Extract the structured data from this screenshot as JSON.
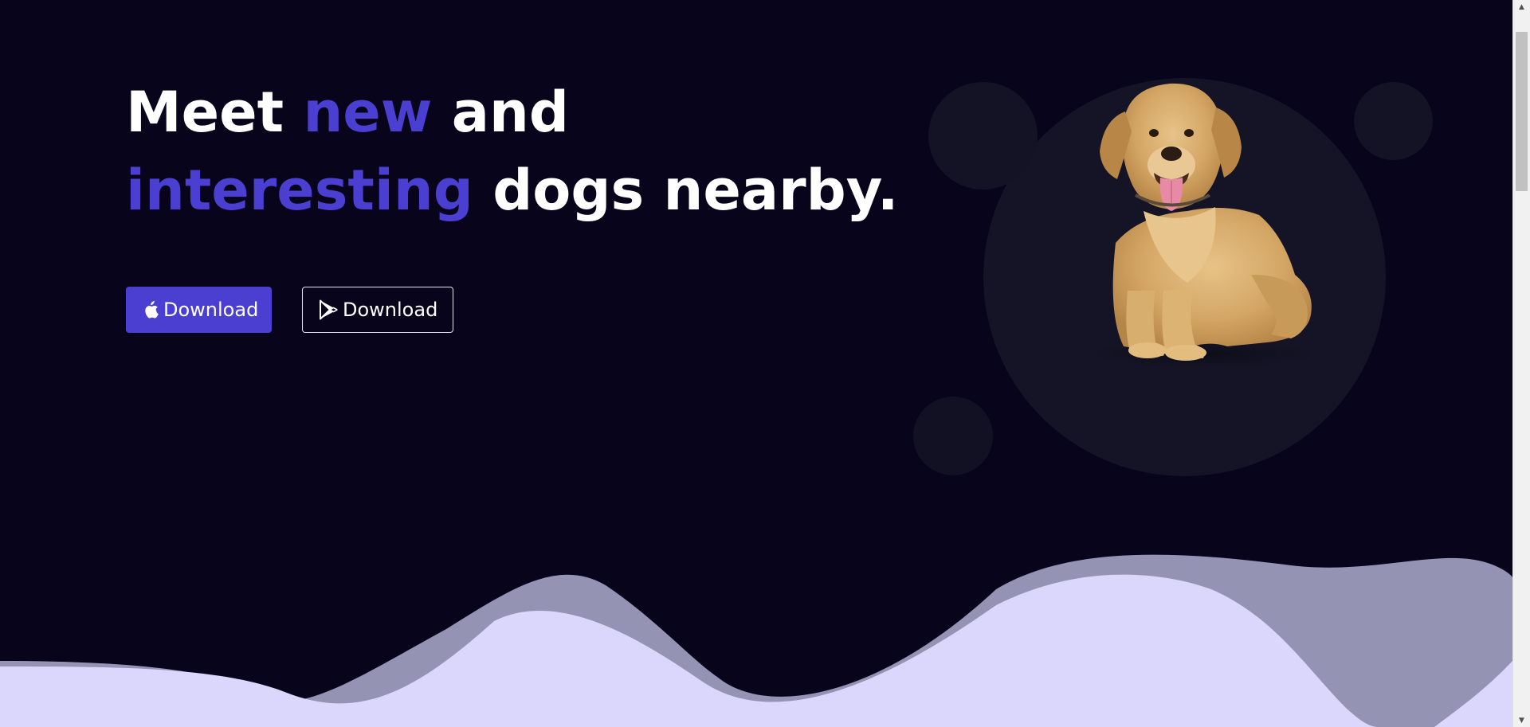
{
  "hero": {
    "headline": {
      "line1_part1": "Meet ",
      "line1_accent": "new",
      "line1_part2": " and",
      "line2_accent": "interesting",
      "line2_part2": " dogs nearby."
    },
    "buttons": {
      "apple_label": "Download",
      "play_label": "Download"
    }
  },
  "icons": {
    "apple": "apple-icon",
    "play": "google-play-icon",
    "scroll_up": "chevron-up-icon",
    "scroll_down": "chevron-down-icon"
  },
  "colors": {
    "background": "#07041c",
    "accent": "#4a3fd0",
    "wave_back": "#9593b3",
    "wave_front": "#dbd6fb",
    "circle": "#151426"
  }
}
